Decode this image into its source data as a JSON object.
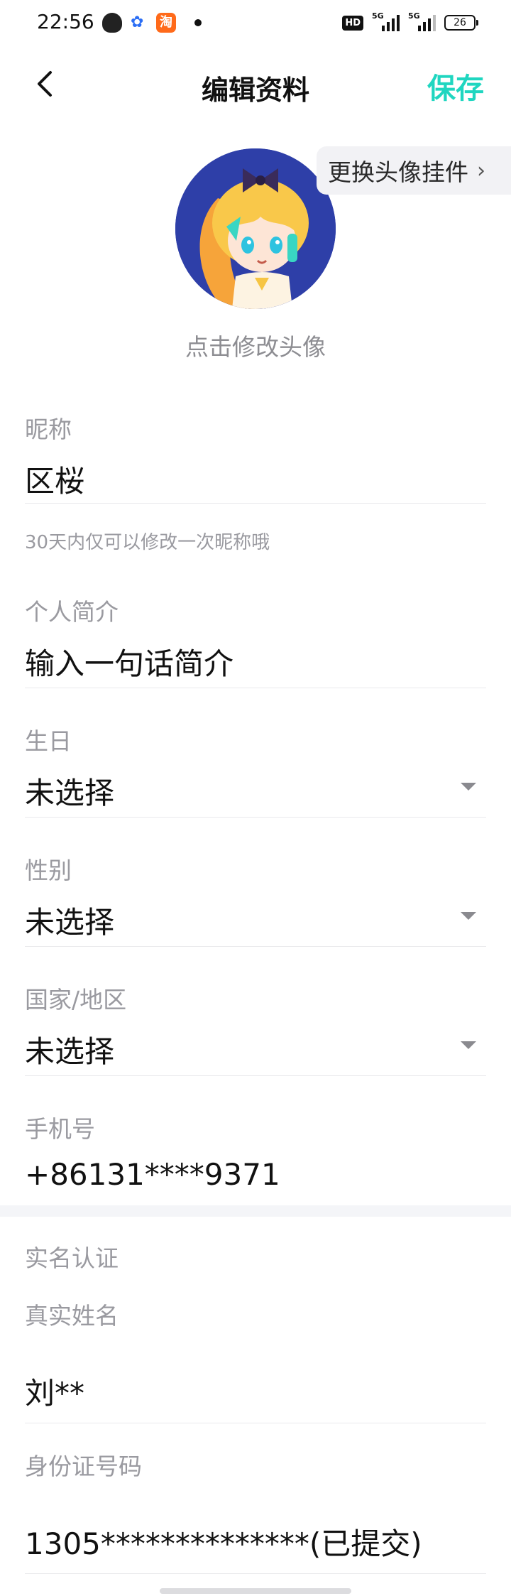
{
  "status_bar": {
    "time": "22:56",
    "app_taobao_label": "淘",
    "app_baidu_glyph": "✿",
    "network_hd": "HD",
    "sim1_label": "5G",
    "sim2_label": "5G",
    "battery_level": "26"
  },
  "nav": {
    "back_icon": "chevron-left-icon",
    "title": "编辑资料",
    "save_label": "保存",
    "accent_color": "#1fd6c0"
  },
  "avatar": {
    "pendant_button_label": "更换头像挂件",
    "pendant_chevron": "›",
    "hint": "点击修改头像"
  },
  "fields": {
    "nickname": {
      "label": "昵称",
      "value": "区桜",
      "note": "30天内仅可以修改一次昵称哦"
    },
    "bio": {
      "label": "个人简介",
      "placeholder": "输入一句话简介"
    },
    "birthday": {
      "label": "生日",
      "value": "未选择"
    },
    "gender": {
      "label": "性别",
      "value": "未选择"
    },
    "region": {
      "label": "国家/地区",
      "value": "未选择"
    },
    "phone": {
      "label": "手机号",
      "value": "+86131****9371"
    }
  },
  "real_name": {
    "section_title": "实名认证",
    "name_label": "真实姓名",
    "name_value": "刘**",
    "id_label": "身份证号码",
    "id_value": "1305**************(已提交)"
  }
}
